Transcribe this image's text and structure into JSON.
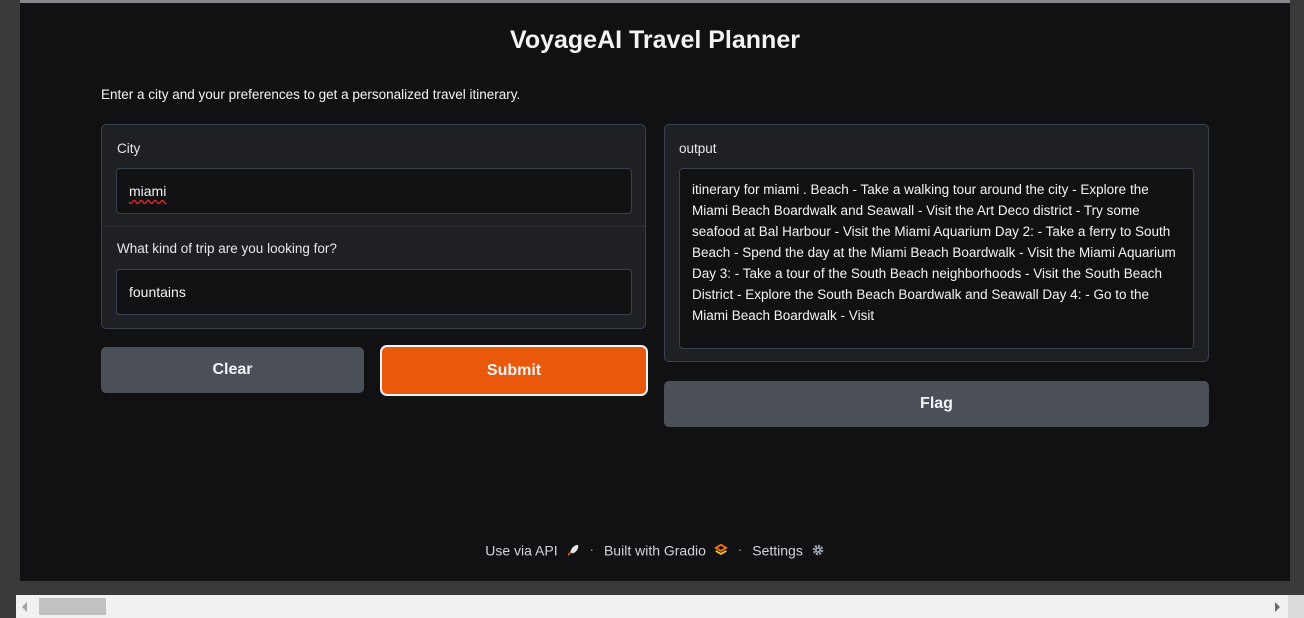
{
  "app": {
    "title": "VoyageAI Travel Planner",
    "description": "Enter a city and your preferences to get a personalized travel itinerary."
  },
  "inputs": {
    "city_label": "City",
    "city_value": "miami",
    "trip_label": "What kind of trip are you looking for?",
    "trip_value": "fountains"
  },
  "output": {
    "label": "output",
    "text": "itinerary for miami . Beach - Take a walking tour around the city - Explore the Miami Beach Boardwalk and Seawall - Visit the Art Deco district - Try some seafood at Bal Harbour - Visit the Miami Aquarium Day 2: - Take a ferry to South Beach - Spend the day at the Miami Beach Boardwalk - Visit the Miami Aquarium Day 3: - Take a tour of the South Beach neighborhoods - Visit the South Beach District - Explore the South Beach Boardwalk and Seawall Day 4: - Go to the Miami Beach Boardwalk - Visit"
  },
  "buttons": {
    "clear": "Clear",
    "submit": "Submit",
    "flag": "Flag"
  },
  "footer": {
    "api": "Use via API",
    "built": "Built with Gradio",
    "settings": "Settings",
    "separator": "·"
  },
  "colors": {
    "accent": "#ea580c",
    "background": "#111113",
    "panel": "#1f2023",
    "secondary_button": "#4b5058"
  },
  "icons": {
    "api": "rocket-icon",
    "gradio": "gradio-logo-icon",
    "settings": "gear-icon"
  }
}
